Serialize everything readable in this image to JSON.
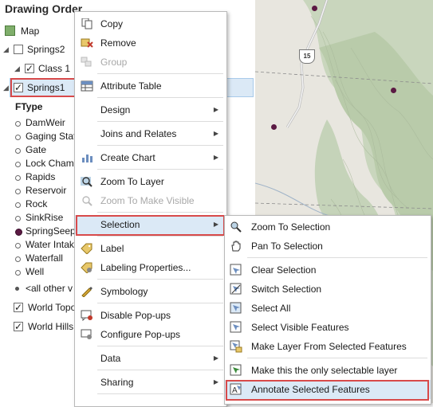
{
  "contents": {
    "title": "Drawing Order",
    "map_label": "Map",
    "layers": {
      "springs2": "Springs2",
      "class1": "Class 1",
      "springs1": "Springs1",
      "field": "FType",
      "world_topo": "World Topo",
      "world_hills": "World Hills"
    },
    "classes": [
      "DamWeir",
      "Gaging Stat",
      "Gate",
      "Lock Cham",
      "Rapids",
      "Reservoir",
      "Rock",
      "SinkRise",
      "SpringSeep",
      "Water Intak",
      "Waterfall",
      "Well"
    ],
    "other_values": "<all other v"
  },
  "menu": {
    "copy": "Copy",
    "remove": "Remove",
    "group": "Group",
    "attribute_table": "Attribute Table",
    "design": "Design",
    "joins_relates": "Joins and Relates",
    "create_chart": "Create Chart",
    "zoom_to_layer": "Zoom To Layer",
    "zoom_to_visible": "Zoom To Make Visible",
    "selection": "Selection",
    "label": "Label",
    "labeling_properties": "Labeling Properties...",
    "symbology": "Symbology",
    "disable_popups": "Disable Pop-ups",
    "configure_popups": "Configure Pop-ups",
    "data": "Data",
    "sharing": "Sharing"
  },
  "submenu": {
    "zoom_to_selection": "Zoom To Selection",
    "pan_to_selection": "Pan To Selection",
    "clear_selection": "Clear Selection",
    "switch_selection": "Switch Selection",
    "select_all": "Select All",
    "select_visible": "Select Visible Features",
    "make_layer": "Make Layer From Selected Features",
    "only_selectable": "Make this the only selectable layer",
    "annotate": "Annotate Selected Features"
  },
  "map": {
    "route_shield": "15"
  },
  "colors": {
    "highlight": "#dbe9f6",
    "callout_red": "#d84a4a",
    "spring_point": "#5b1a43"
  }
}
